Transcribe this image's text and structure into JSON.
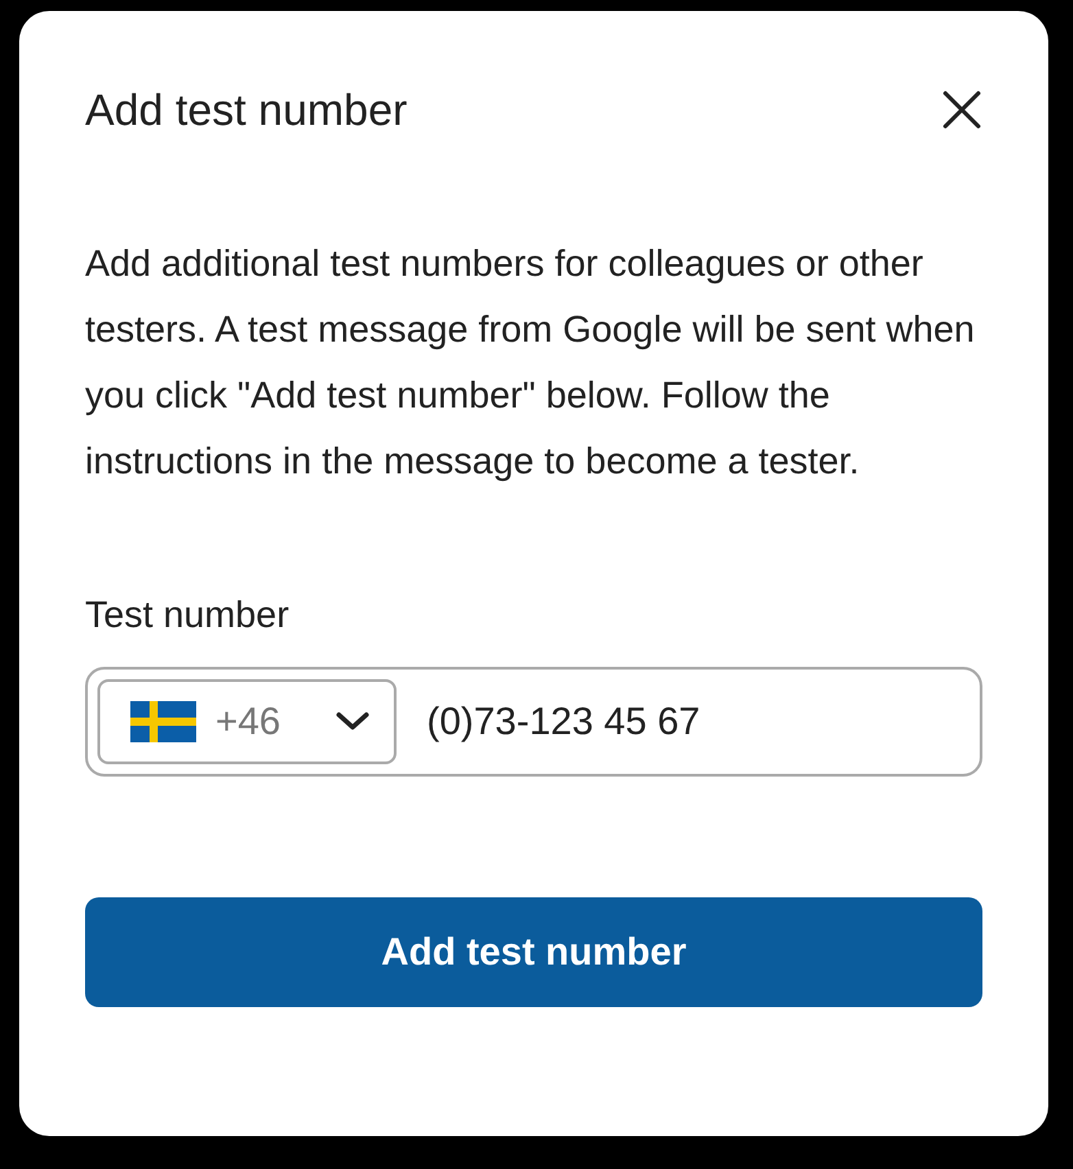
{
  "dialog": {
    "title": "Add test number",
    "description": "Add additional test numbers for colleagues or other testers. A test message from Google will be sent when you click \"Add test number\" below. Follow the instructions in the message to become a tester.",
    "field": {
      "label": "Test number",
      "country_code": "+46",
      "value": "(0)73-123 45 67"
    },
    "submit_button": "Add test number"
  }
}
